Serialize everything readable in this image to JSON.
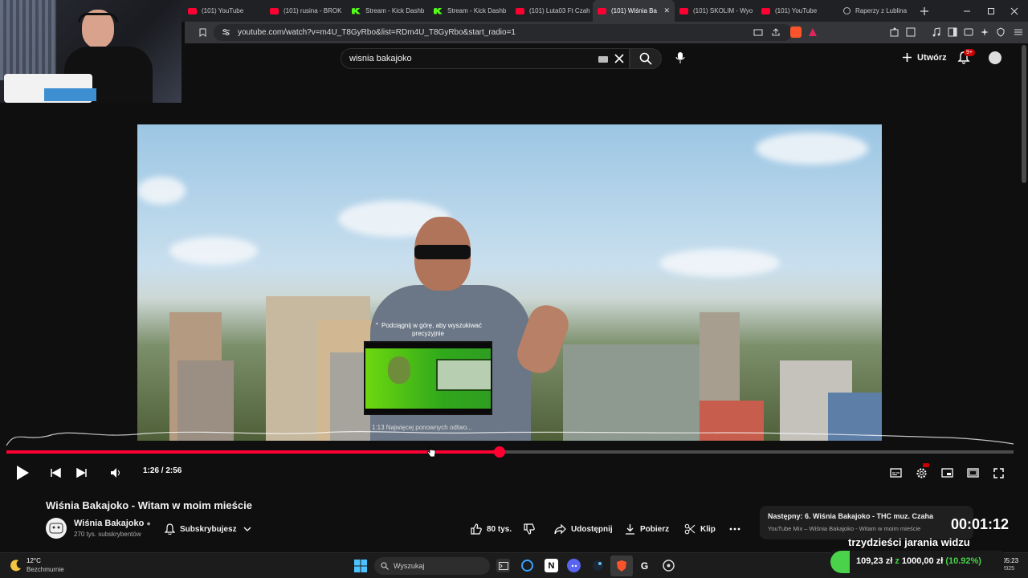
{
  "browser": {
    "tabs": [
      {
        "label": "(101) YouTube",
        "icon": "youtube-icon",
        "active": false
      },
      {
        "label": "(101) rusina - BROK",
        "icon": "youtube-icon",
        "active": false
      },
      {
        "label": "Stream - Kick Dashb",
        "icon": "kick-icon",
        "active": false
      },
      {
        "label": "Stream - Kick Dashb",
        "icon": "kick-icon",
        "active": false
      },
      {
        "label": "(101) Luta03 Ft Czah",
        "icon": "youtube-icon",
        "active": false
      },
      {
        "label": "(101) Wiśnia Ba",
        "icon": "youtube-icon",
        "active": true
      },
      {
        "label": "(101) SKOLIM - Wyo",
        "icon": "youtube-icon",
        "active": false
      },
      {
        "label": "(101) YouTube",
        "icon": "youtube-icon",
        "active": false
      },
      {
        "label": "Raperzy z Lublina",
        "icon": "globe-icon",
        "active": false
      }
    ],
    "url": "youtube.com/watch?v=m4U_T8GyRbo&list=RDm4U_T8GyRbo&start_radio=1"
  },
  "youtube": {
    "search_value": "wisnia bakajoko",
    "create_label": "Utwórz",
    "notif_badge": "9+"
  },
  "player": {
    "scrub_hint": "Podciągnij w górę, aby wyszukiwać precyzyjnie",
    "preview_chapter": "1:13  Najwięcej ponownych odtwo...",
    "time_display": "1:26 / 2:56",
    "played_fraction": 0.49,
    "hover_fraction": 0.42
  },
  "video": {
    "title": "Wiśnia Bakajoko - Witam w moim mieście",
    "channel": "Wiśnia Bakajoko",
    "subscribers": "270 tys. subskrybentów",
    "subscribe_label": "Subskrybujesz",
    "likes": "80 tys.",
    "share_label": "Udostępnij",
    "download_label": "Pobierz",
    "clip_label": "Klip"
  },
  "next_card": {
    "title": "Następny: 6. Wiśnia Bakajoko - THC muz. Czaha",
    "subtitle": "YouTube Mix – Wiśnia Bakajoko - Witam w moim mieście"
  },
  "stream_overlay": {
    "timer": "00:01:12",
    "caption": "trzydzieści jarania widzu",
    "donation_main": "109,23 zł",
    "donation_sep": "z",
    "donation_goal": "1000,00 zł",
    "donation_pct": "(10.92%)",
    "donation_progress": 0.1092
  },
  "taskbar": {
    "weather_temp": "12°C",
    "weather_desc": "Bezchmurnie",
    "search_placeholder": "Wyszukaj",
    "clock_time": "05:23",
    "clock_date": "28.08.2025"
  },
  "colors": {
    "accent": "#ff0033",
    "donation_green": "#49d24a"
  }
}
